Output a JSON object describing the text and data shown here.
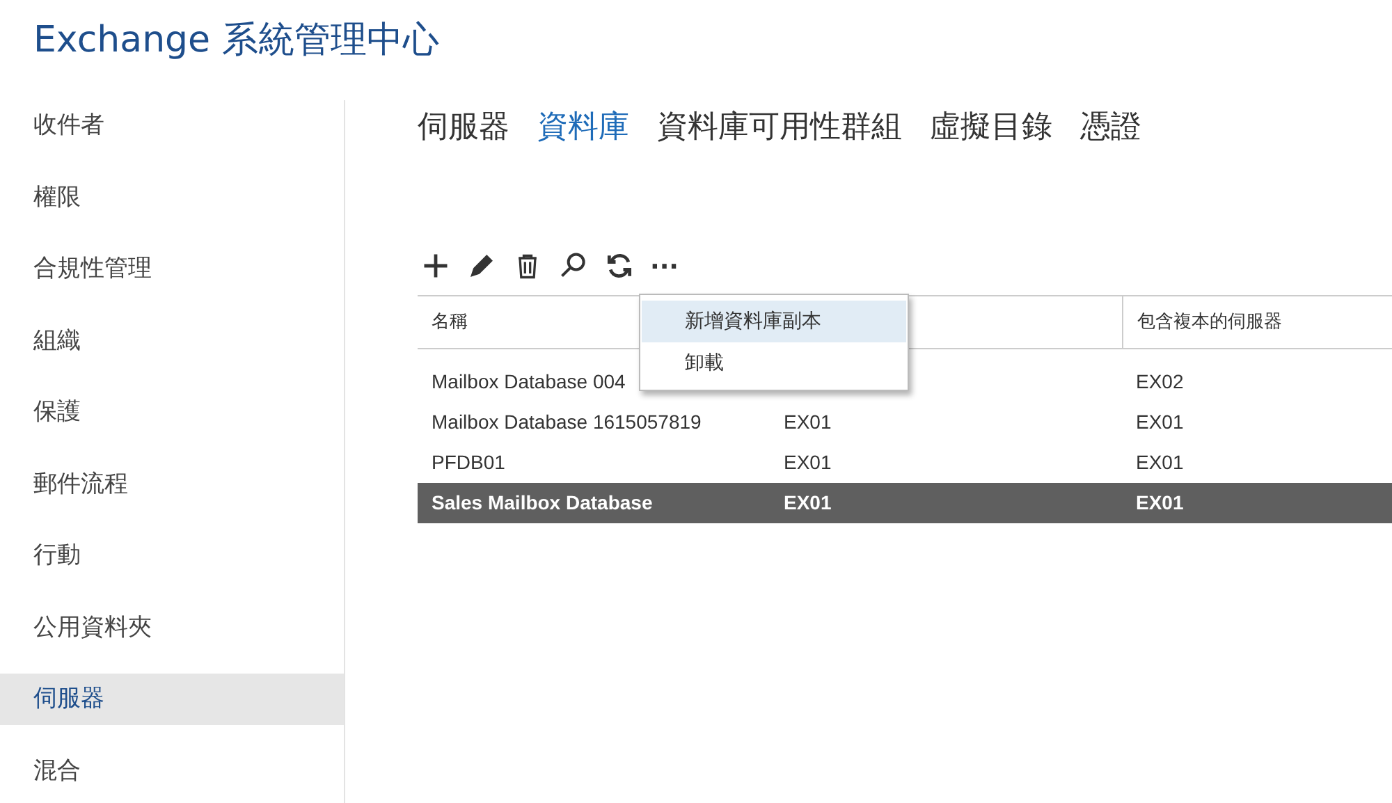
{
  "app_title": "Exchange 系統管理中心",
  "sidebar": {
    "items": [
      {
        "label": "收件者",
        "selected": false
      },
      {
        "label": "權限",
        "selected": false
      },
      {
        "label": "合規性管理",
        "selected": false
      },
      {
        "label": "組織",
        "selected": false
      },
      {
        "label": "保護",
        "selected": false
      },
      {
        "label": "郵件流程",
        "selected": false
      },
      {
        "label": "行動",
        "selected": false
      },
      {
        "label": "公用資料夾",
        "selected": false
      },
      {
        "label": "伺服器",
        "selected": true
      },
      {
        "label": "混合",
        "selected": false
      }
    ]
  },
  "tabs": [
    {
      "label": "伺服器",
      "selected": false
    },
    {
      "label": "資料庫",
      "selected": true
    },
    {
      "label": "資料庫可用性群組",
      "selected": false
    },
    {
      "label": "虛擬目錄",
      "selected": false
    },
    {
      "label": "憑證",
      "selected": false
    }
  ],
  "toolbar": [
    {
      "kind": "add"
    },
    {
      "kind": "edit"
    },
    {
      "kind": "delete"
    },
    {
      "kind": "search"
    },
    {
      "kind": "refresh"
    },
    {
      "kind": "more",
      "label": "..."
    }
  ],
  "table": {
    "columns": [
      "名稱",
      null,
      "包含複本的伺服器"
    ],
    "rows": [
      {
        "cells": [
          "Mailbox Database 004",
          null,
          "EX02"
        ],
        "selected": false
      },
      {
        "cells": [
          "Mailbox Database 1615057819",
          "EX01",
          "EX01"
        ],
        "selected": false
      },
      {
        "cells": [
          "PFDB01",
          "EX01",
          "EX01"
        ],
        "selected": false
      },
      {
        "cells": [
          "Sales Mailbox Database",
          "EX01",
          "EX01"
        ],
        "selected": true
      }
    ]
  },
  "menu": {
    "items": [
      {
        "label": "新增資料庫副本",
        "selected": true
      },
      {
        "label": "卸載",
        "selected": false
      }
    ]
  }
}
